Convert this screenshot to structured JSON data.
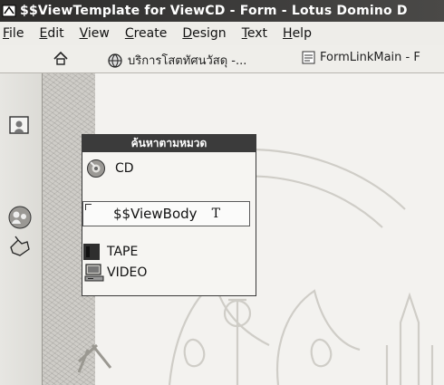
{
  "window": {
    "title": "$$ViewTemplate for ViewCD - Form - Lotus Domino D"
  },
  "menubar": {
    "items": [
      {
        "label": "File",
        "accel_index": 0
      },
      {
        "label": "Edit",
        "accel_index": 0
      },
      {
        "label": "View",
        "accel_index": 0
      },
      {
        "label": "Create",
        "accel_index": 0
      },
      {
        "label": "Design",
        "accel_index": 0
      },
      {
        "label": "Text",
        "accel_index": 0
      },
      {
        "label": "Help",
        "accel_index": 0
      }
    ]
  },
  "tabs": [
    {
      "label": "",
      "icon": "home-icon"
    },
    {
      "label": "บริการโสตทัศนวัสดุ -...",
      "icon": "globe-icon"
    },
    {
      "label": "FormLinkMain - F",
      "icon": "form-icon"
    }
  ],
  "left_rail": {
    "buttons": [
      {
        "icon": "bookmark-icon"
      },
      {
        "icon": "people-icon"
      },
      {
        "icon": "hand-pointer-icon"
      }
    ]
  },
  "panel": {
    "header": "ค้นหาตามหมวด",
    "items": [
      {
        "label": "CD",
        "icon": "cd-icon"
      },
      {
        "label": "TAPE",
        "icon": "tape-icon"
      },
      {
        "label": "VIDEO",
        "icon": "video-icon"
      }
    ],
    "field": {
      "label": "$$ViewBody",
      "type_marker": "T"
    }
  },
  "colors": {
    "titlebar": "#3a3938",
    "panel_header": "#3b3b3b",
    "background": "#f3f2ef"
  }
}
